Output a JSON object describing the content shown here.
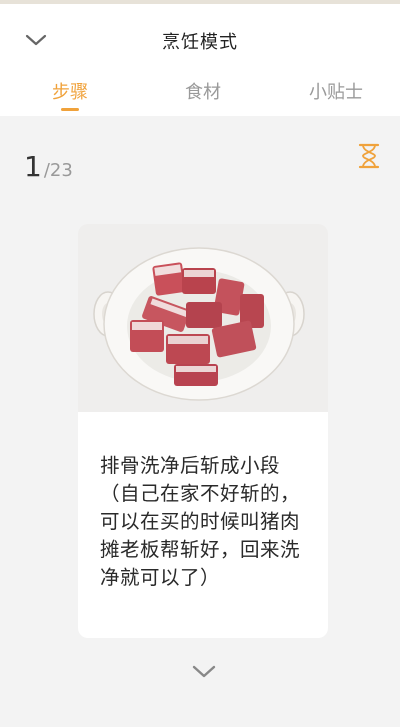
{
  "header": {
    "title": "烹饪模式"
  },
  "tabs": [
    {
      "label": "步骤",
      "active": true
    },
    {
      "label": "食材",
      "active": false
    },
    {
      "label": "小贴士",
      "active": false
    }
  ],
  "step": {
    "current": "1",
    "total_text": "/23"
  },
  "card": {
    "instruction": "排骨洗净后斩成小段（自己在家不好斩的，可以在买的时候叫猪肉摊老板帮斩好，回来洗净就可以了）"
  },
  "colors": {
    "accent": "#f0a23b",
    "background": "#f3f3f3"
  },
  "icons": {
    "back": "chevron-down-icon",
    "timer": "hourglass-icon",
    "next": "chevron-down-icon"
  }
}
